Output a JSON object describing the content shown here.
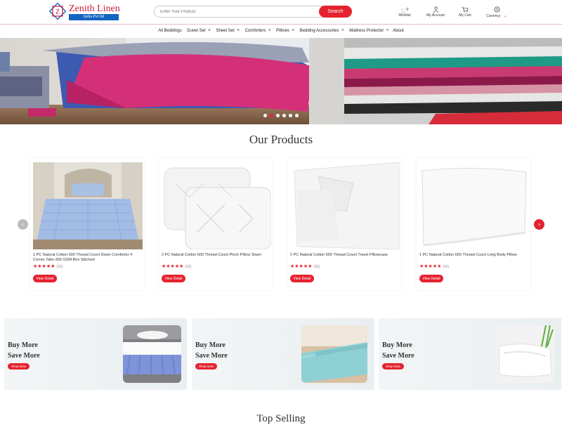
{
  "brand": {
    "name": "Zenith Linen",
    "tagline": "India Pvt ltd"
  },
  "search": {
    "placeholder": "Enter Your Product",
    "button_label": "Search"
  },
  "header_icons": {
    "wishlist": {
      "label": "Wishlist",
      "count": "0"
    },
    "account": {
      "label": "My Account"
    },
    "cart": {
      "label": "My Cart"
    },
    "currency": {
      "label": "Currency"
    }
  },
  "nav": {
    "items": [
      "All Beddings",
      "Duvet Set",
      "Sheet Set",
      "Comforters",
      "Pillows",
      "Bedding Accessories",
      "Mattress Protector",
      "About"
    ]
  },
  "hero": {
    "slide_count": 6,
    "active_slide": 2
  },
  "products_section": {
    "title": "Our Products"
  },
  "products": [
    {
      "name": "1 PC Natural Cotton 600 Thread Count Down Comforter 4 Corner Tabs-300 GSM-Box Stitched",
      "stars": "★★★★★",
      "reviews": "(15)",
      "button": "View Detail"
    },
    {
      "name": "2 PC Natural Cotton 600 Thread Count Pinch Pillow Sham",
      "stars": "★★★★★",
      "reviews": "(15)",
      "button": "View Detail"
    },
    {
      "name": "2 PC Natural Cotton 600 Thread Count Travel Pillowcase",
      "stars": "★★★★★",
      "reviews": "(15)",
      "button": "View Detail"
    },
    {
      "name": "1 PC Natural Cotton 600 Thread Count Long Body Pillow",
      "stars": "★★★★★",
      "reviews": "(15)",
      "button": "View Detail"
    }
  ],
  "carousel": {
    "prev_icon": "chevron-left-icon",
    "next_icon": "chevron-right-icon"
  },
  "promos": [
    {
      "line1": "Buy More",
      "line2": "Save More",
      "button": "Shop Now"
    },
    {
      "line1": "Buy More",
      "line2": "Save More",
      "button": "Shop Now"
    },
    {
      "line1": "Buy More",
      "line2": "Save More",
      "button": "Shop Now"
    }
  ],
  "top_selling": {
    "title": "Top Selling"
  },
  "colors": {
    "accent": "#e5222f",
    "brand": "#c81d3a",
    "tagline_bg": "#1565c0"
  }
}
